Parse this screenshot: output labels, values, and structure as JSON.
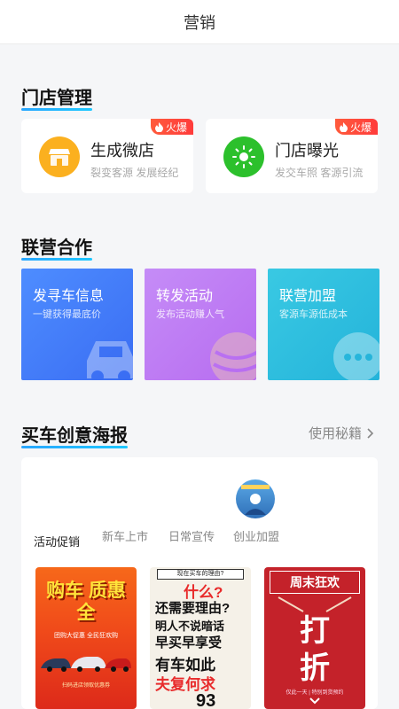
{
  "topbar": {
    "title": "营销"
  },
  "store_section": {
    "title": "门店管理",
    "hot_label": "火爆",
    "cards": [
      {
        "name": "生成微店",
        "desc": "裂变客源 发展经纪",
        "icon": "shop-icon",
        "color": "#fbb01f"
      },
      {
        "name": "门店曝光",
        "desc": "发交车照 客源引流",
        "icon": "sun-icon",
        "color": "#2cc02c"
      }
    ]
  },
  "coop_section": {
    "title": "联营合作",
    "cards": [
      {
        "title": "发寻车信息",
        "sub": "一键获得最底价",
        "icon": "car-icon"
      },
      {
        "title": "转发活动",
        "sub": "发布活动赚人气",
        "icon": "balloon-icon"
      },
      {
        "title": "联营加盟",
        "sub": "客源车源低成本",
        "icon": "chat-icon"
      }
    ]
  },
  "poster_section": {
    "title": "买车创意海报",
    "secret_label": "使用秘籍",
    "tabs": [
      "活动促销",
      "新车上市",
      "日常宣传",
      "创业加盟"
    ],
    "posters": [
      {
        "headline": "购车 质惠全",
        "sub": "团购大促惠 全民狂欢购",
        "footer": "扫码进店领取优惠券"
      },
      {
        "banner": "现在买车的理由?",
        "lines": [
          "什么?",
          "还需要理由?",
          "明人不说暗话",
          "早买早享受",
          "有车如此",
          "夫复何求"
        ],
        "number": "93"
      },
      {
        "headline": "周末狂欢",
        "big1": "打",
        "big2": "折",
        "footer": "仅此一天 | 特别到货预约"
      }
    ]
  }
}
